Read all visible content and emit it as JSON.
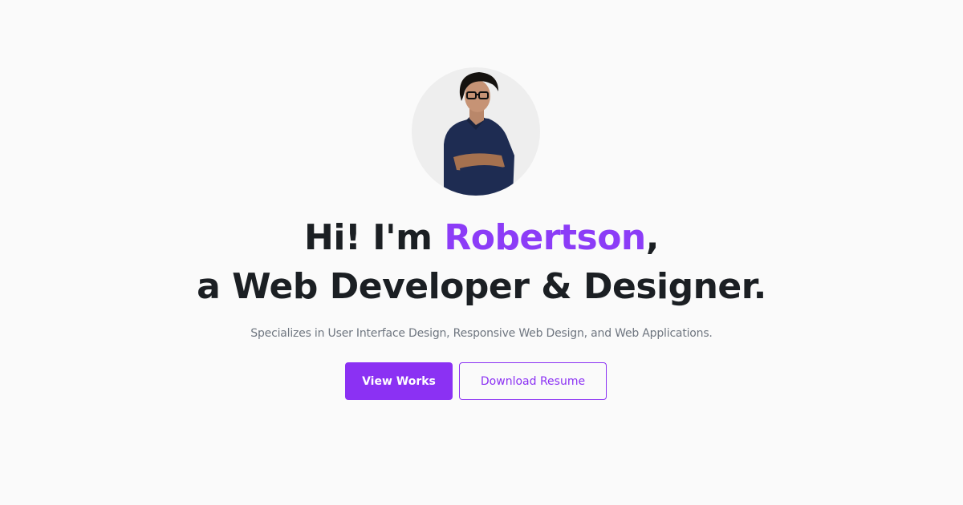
{
  "hero": {
    "greeting_prefix": "Hi! I'm ",
    "name": "Robertson",
    "greeting_suffix": ",",
    "role_line": "a Web Developer & Designer.",
    "subtitle": "Specializes in User Interface Design, Responsive Web Design, and Web Applications.",
    "primary_button_label": "View Works",
    "secondary_button_label": "Download Resume"
  },
  "colors": {
    "accent": "#8c3cf7",
    "heading": "#1b1f23",
    "muted_text": "#6f7680",
    "background": "#fafafa",
    "avatar_bg": "#eeeeee"
  }
}
